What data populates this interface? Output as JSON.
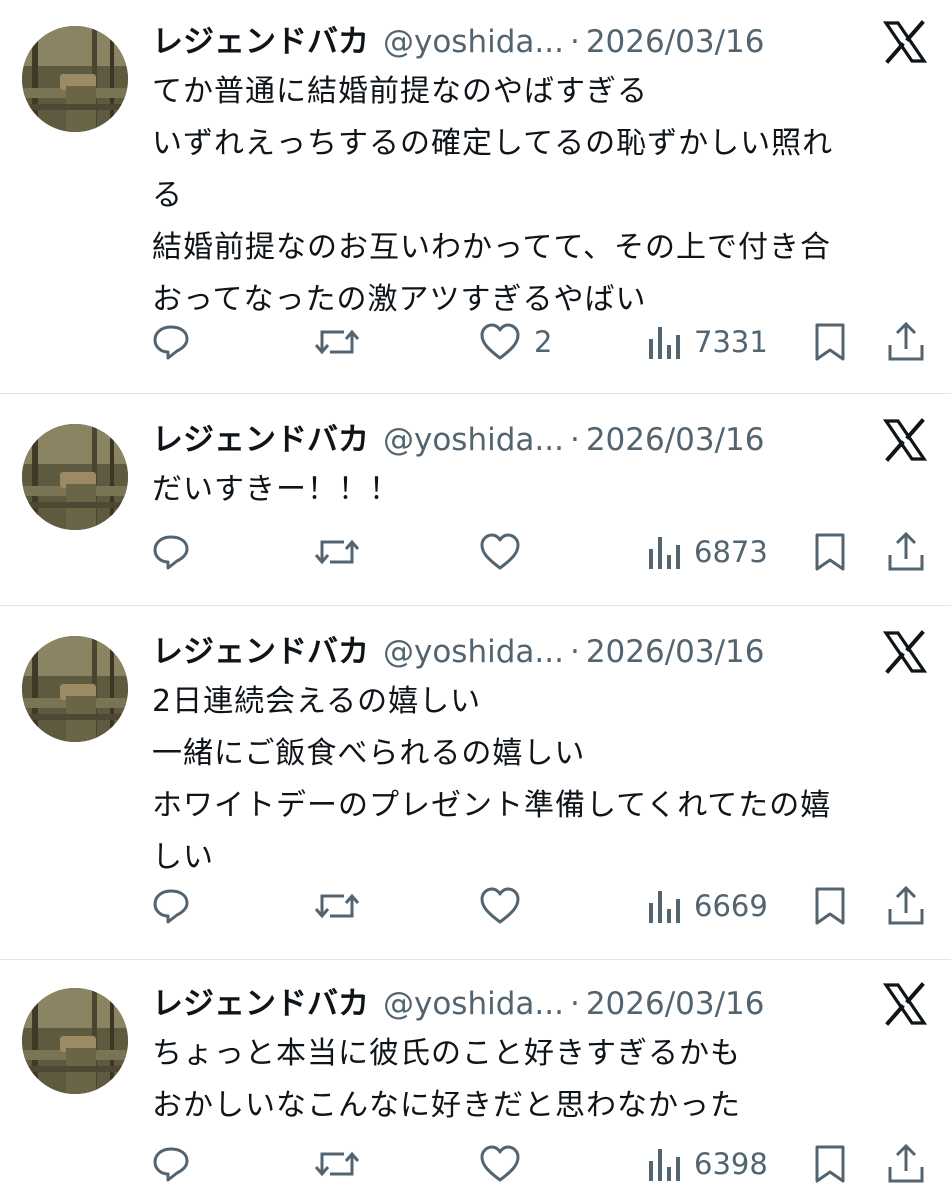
{
  "tweets": [
    {
      "name": "レジェンドバカ",
      "handle": "@yoshida...",
      "separator": "·",
      "date": "2026/03/16",
      "lines": [
        "てか普通に結婚前提なのやばすぎる",
        "いずれえっちするの確定してるの恥ずかしい照れ",
        "る",
        "結婚前提なのお互いわかってて、その上で付き合",
        "おってなったの激アツすぎるやばい"
      ],
      "likes": "2",
      "views": "7331"
    },
    {
      "name": "レジェンドバカ",
      "handle": "@yoshida...",
      "separator": "·",
      "date": "2026/03/16",
      "lines": [
        "だいすきー！！！"
      ],
      "likes": "",
      "views": "6873"
    },
    {
      "name": "レジェンドバカ",
      "handle": "@yoshida...",
      "separator": "·",
      "date": "2026/03/16",
      "lines": [
        "2日連続会えるの嬉しい",
        "一緒にご飯食べられるの嬉しい",
        "ホワイトデーのプレゼント準備してくれてたの嬉",
        "しい"
      ],
      "likes": "",
      "views": "6669"
    },
    {
      "name": "レジェンドバカ",
      "handle": "@yoshida...",
      "separator": "·",
      "date": "2026/03/16",
      "lines": [
        "ちょっと本当に彼氏のこと好きすぎるかも",
        "おかしいなこんなに好きだと思わなかった"
      ],
      "likes": "",
      "views": "6398"
    }
  ],
  "icons": {
    "platform": "x-logo-icon",
    "reply": "reply-icon",
    "repost": "repost-icon",
    "like": "heart-icon",
    "views": "views-chart-icon",
    "bookmark": "bookmark-icon",
    "share": "share-icon"
  },
  "colors": {
    "text": "#0f1419",
    "secondary": "#536471",
    "divider": "#e1e4e8",
    "background": "#ffffff"
  }
}
